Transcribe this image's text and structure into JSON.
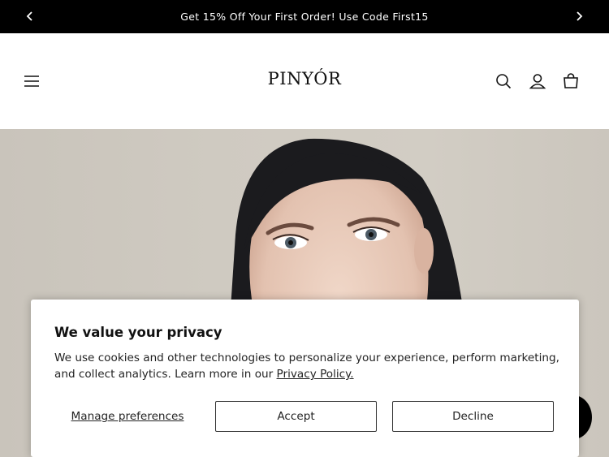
{
  "announcement": {
    "message": "Get 15% Off Your First Order! Use Code First15",
    "prev_icon": "chevron-left-icon",
    "next_icon": "chevron-right-icon"
  },
  "header": {
    "logo": "PINYÓR",
    "menu_icon": "hamburger-menu-icon",
    "search_icon": "search-icon",
    "account_icon": "account-icon",
    "cart_icon": "cart-icon"
  },
  "hero": {
    "image": "model-portrait-photo"
  },
  "cookie_banner": {
    "title": "We value your privacy",
    "body_text": "We use cookies and other technologies to personalize your experience, perform marketing, and collect analytics. Learn more in our ",
    "privacy_link": "Privacy Policy.",
    "manage_label": "Manage preferences",
    "accept_label": "Accept",
    "decline_label": "Decline"
  },
  "chat": {
    "icon": "chat-bubble-icon"
  },
  "colors": {
    "announcement_bg": "#000000",
    "text": "#121212",
    "hero_bg": "#cfcac1"
  }
}
